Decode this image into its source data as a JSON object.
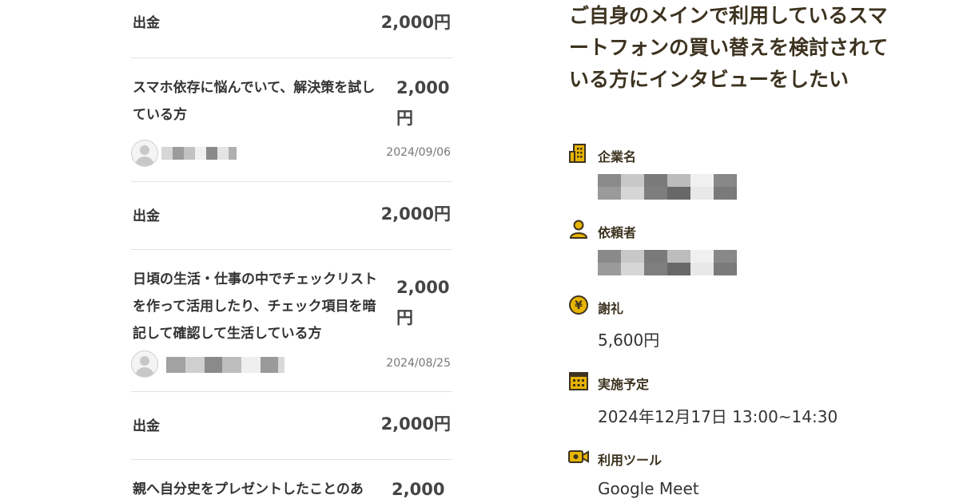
{
  "history": {
    "rows": [
      {
        "type": "withdrawal",
        "label": "出金",
        "amount": "2,000円"
      },
      {
        "type": "request",
        "title": "スマホ依存に悩んでいて、解決策を試している方",
        "amount": "2,000円",
        "date": "2024/09/06"
      },
      {
        "type": "withdrawal",
        "label": "出金",
        "amount": "2,000円"
      },
      {
        "type": "request",
        "title": "日頃の生活・仕事の中でチェックリストを作って活用したり、チェック項目を暗記して確認して生活している方",
        "amount": "2,000円",
        "date": "2024/08/25"
      },
      {
        "type": "withdrawal",
        "label": "出金",
        "amount": "2,000円"
      },
      {
        "type": "request",
        "title": "親へ自分史をプレゼントしたことのあ",
        "amount": "2,000"
      }
    ]
  },
  "detail": {
    "title": "ご自身のメインで利用しているスマートフォンの買い替えを検討されている方にインタビューをしたい",
    "fields": {
      "company": {
        "label": "企業名",
        "icon": "building-icon"
      },
      "requester": {
        "label": "依頼者",
        "icon": "person-icon"
      },
      "reward": {
        "label": "謝礼",
        "value": "5,600円",
        "icon": "yen-icon"
      },
      "schedule": {
        "label": "実施予定",
        "value": "2024年12月17日 13:00~14:30",
        "icon": "calendar-icon"
      },
      "tool": {
        "label": "利用ツール",
        "value": "Google Meet",
        "icon": "video-camera-icon"
      }
    },
    "accent_color": "#e8b400"
  }
}
